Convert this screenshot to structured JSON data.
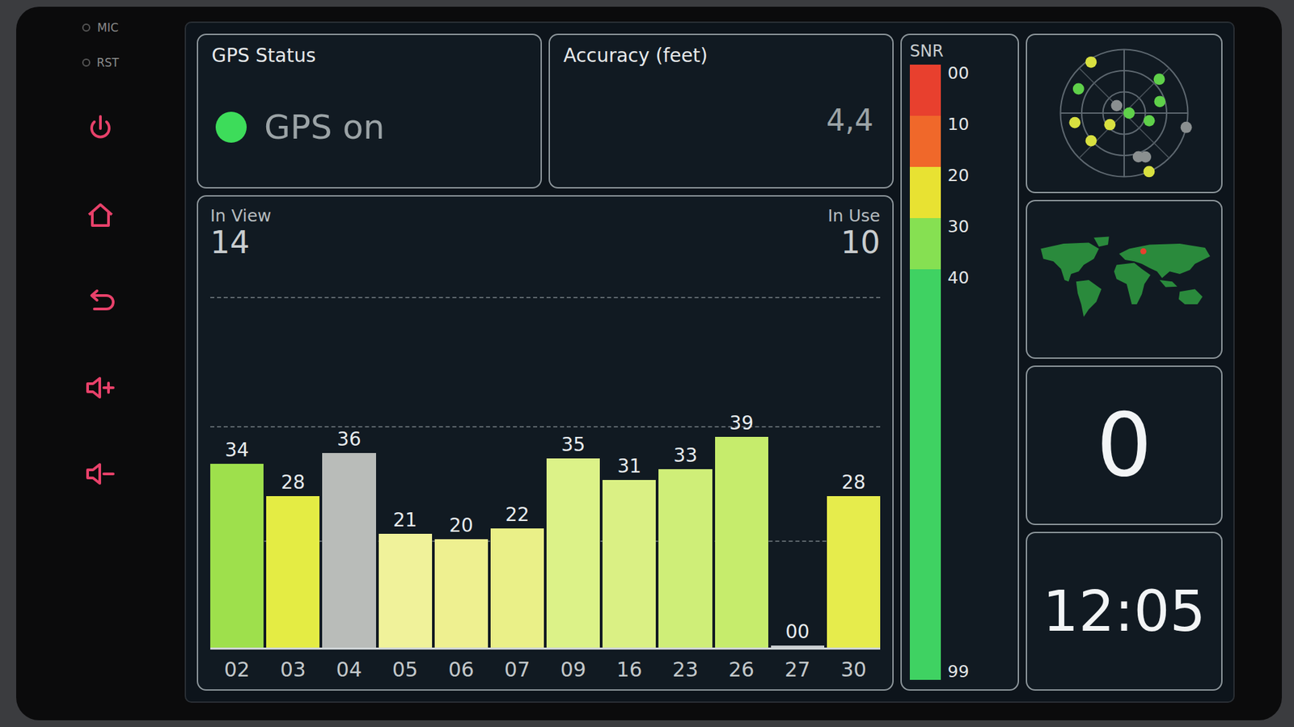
{
  "bezel": {
    "labels": [
      "MIC",
      "RST"
    ]
  },
  "gps_status": {
    "title": "GPS Status",
    "label": "GPS on",
    "on": true,
    "color": "#3ddc5a"
  },
  "accuracy": {
    "title": "Accuracy (feet)",
    "value": "4,4"
  },
  "satellites": {
    "in_view_label": "In View",
    "in_view": "14",
    "in_use_label": "In Use",
    "in_use": "10",
    "axis_max": 55,
    "bars": [
      {
        "id": "02",
        "label": "34",
        "value": 34,
        "color": "#9ee04c"
      },
      {
        "id": "03",
        "label": "28",
        "value": 28,
        "color": "#e4ec44"
      },
      {
        "id": "04",
        "label": "36",
        "value": 36,
        "color": "#b9bcb9"
      },
      {
        "id": "05",
        "label": "21",
        "value": 21,
        "color": "#f0f29a"
      },
      {
        "id": "06",
        "label": "20",
        "value": 20,
        "color": "#eef090"
      },
      {
        "id": "07",
        "label": "22",
        "value": 22,
        "color": "#eaf088"
      },
      {
        "id": "09",
        "label": "35",
        "value": 35,
        "color": "#dcf288"
      },
      {
        "id": "16",
        "label": "31",
        "value": 31,
        "color": "#daf084"
      },
      {
        "id": "23",
        "label": "33",
        "value": 33,
        "color": "#cfee78"
      },
      {
        "id": "26",
        "label": "39",
        "value": 39,
        "color": "#c6ec6c"
      },
      {
        "id": "27",
        "label": "00",
        "value": 0,
        "color": "#d8f070"
      },
      {
        "id": "30",
        "label": "28",
        "value": 28,
        "color": "#e6ec4c"
      }
    ]
  },
  "snr_scale": {
    "title": "SNR",
    "ticks": [
      "00",
      "10",
      "20",
      "30",
      "40",
      "99"
    ],
    "segments": [
      {
        "color": "#e8402e"
      },
      {
        "color": "#f0682a"
      },
      {
        "color": "#e8e232"
      },
      {
        "color": "#86e052"
      },
      {
        "color": "#3fd262"
      }
    ]
  },
  "sky_plot": {
    "satellites": [
      {
        "azimuth": 327,
        "elevation": 4,
        "color": "#d8e040"
      },
      {
        "azimuth": 298,
        "elevation": 17,
        "color": "#5fd04a"
      },
      {
        "azimuth": 46,
        "elevation": 21,
        "color": "#5fd04a"
      },
      {
        "azimuth": 315,
        "elevation": 75,
        "color": "#8a8f90"
      },
      {
        "azimuth": 90,
        "elevation": 83,
        "color": "#5fd04a"
      },
      {
        "azimuth": 72,
        "elevation": 37,
        "color": "#5fd04a"
      },
      {
        "azimuth": 259,
        "elevation": 19,
        "color": "#d8e040"
      },
      {
        "azimuth": 230,
        "elevation": 29,
        "color": "#d8e040"
      },
      {
        "azimuth": 231,
        "elevation": 64,
        "color": "#d8e040"
      },
      {
        "azimuth": 107,
        "elevation": 53,
        "color": "#5fd04a"
      },
      {
        "azimuth": 103,
        "elevation": 0,
        "color": "#8a8f90"
      },
      {
        "azimuth": 162,
        "elevation": 25,
        "color": "#8a8f90"
      },
      {
        "azimuth": 154,
        "elevation": 21,
        "color": "#8a8f90"
      },
      {
        "azimuth": 157,
        "elevation": 0,
        "color": "#d8e040"
      }
    ]
  },
  "world_map": {
    "location": {
      "lat": 55,
      "lon": 38
    }
  },
  "speed": {
    "value": "0"
  },
  "clock": {
    "time": "12:05"
  }
}
